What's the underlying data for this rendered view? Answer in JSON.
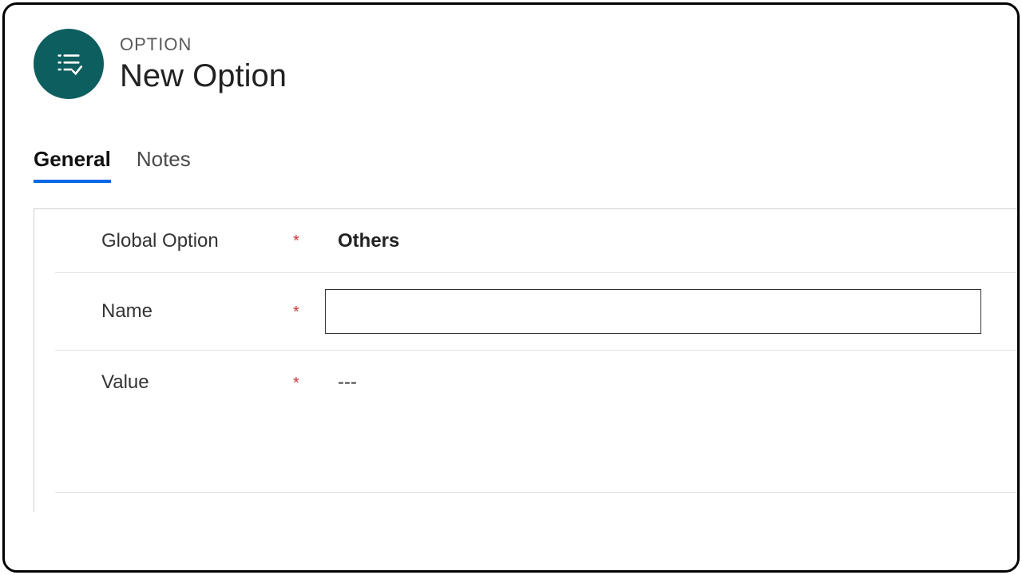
{
  "header": {
    "eyebrow": "OPTION",
    "title": "New Option"
  },
  "tabs": {
    "general": "General",
    "notes": "Notes"
  },
  "form": {
    "required_mark": "*",
    "global_option": {
      "label": "Global Option",
      "value": "Others"
    },
    "name": {
      "label": "Name",
      "value": ""
    },
    "value_field": {
      "label": "Value",
      "value": "---"
    }
  }
}
